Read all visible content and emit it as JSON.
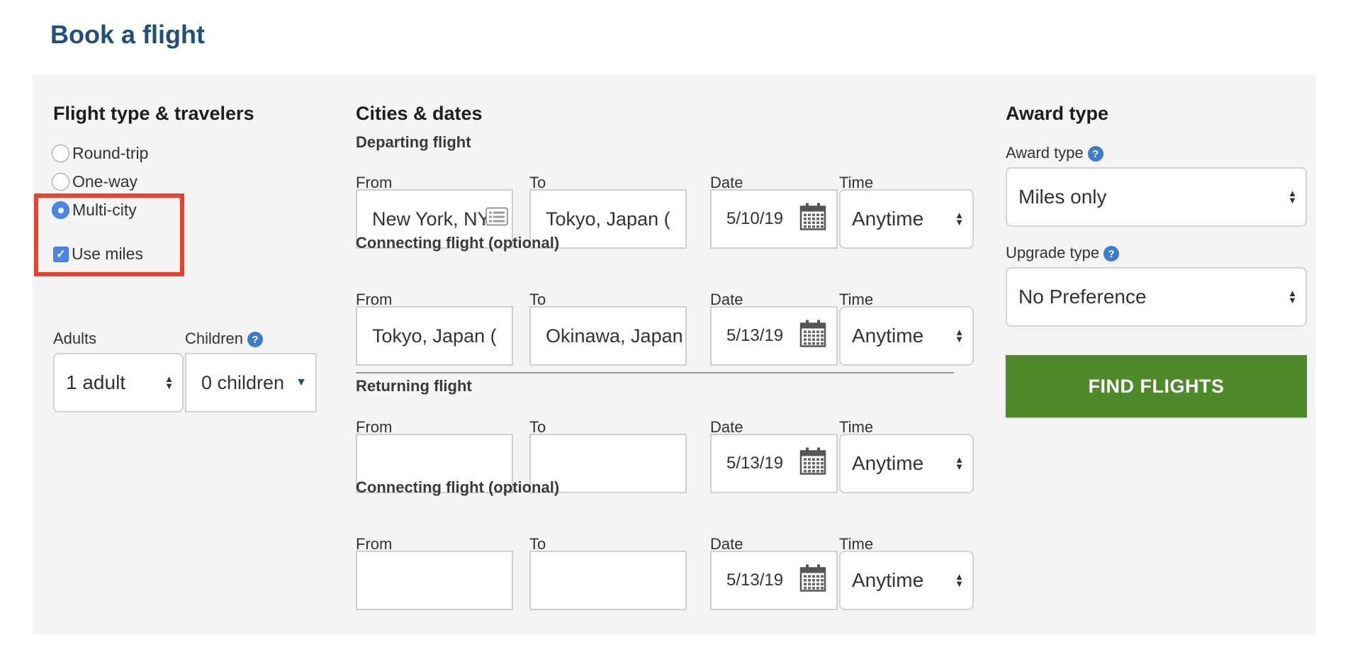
{
  "page": {
    "title": "Book a flight"
  },
  "flight_type": {
    "title": "Flight type & travelers",
    "options": [
      {
        "label": "Round-trip",
        "selected": false
      },
      {
        "label": "One-way",
        "selected": false
      },
      {
        "label": "Multi-city",
        "selected": true
      }
    ],
    "use_miles": {
      "label": "Use miles",
      "checked": true
    }
  },
  "travelers": {
    "adults_label": "Adults",
    "adults_value": "1 adult",
    "children_label": "Children",
    "children_value": "0 children"
  },
  "cities": {
    "title": "Cities & dates",
    "from_label": "From",
    "to_label": "To",
    "date_label": "Date",
    "time_label": "Time",
    "segments": [
      {
        "heading": "Departing flight",
        "from": "New York, NY",
        "to": "Tokyo, Japan (",
        "date": "5/10/19",
        "time": "Anytime"
      },
      {
        "heading": "Connecting flight (optional)",
        "from": "Tokyo, Japan (",
        "to": "Okinawa, Japan",
        "date": "5/13/19",
        "time": "Anytime"
      },
      {
        "heading": "Returning flight",
        "from": "",
        "to": "",
        "date": "5/13/19",
        "time": "Anytime"
      },
      {
        "heading": "Connecting flight (optional)",
        "from": "",
        "to": "",
        "date": "5/13/19",
        "time": "Anytime"
      }
    ]
  },
  "award": {
    "title": "Award type",
    "award_type_label": "Award type",
    "award_type_value": "Miles only",
    "upgrade_type_label": "Upgrade type",
    "upgrade_type_value": "No Preference",
    "find_label": "FIND FLIGHTS"
  },
  "colors": {
    "title": "#1f4f7a",
    "panel": "#f4f4f4",
    "highlight": "#e8432a",
    "find_button": "#4e8a2a",
    "accent": "#4a86e8"
  }
}
